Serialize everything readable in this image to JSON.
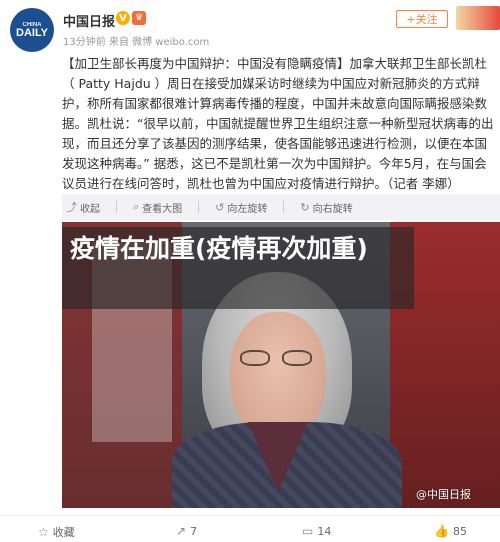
{
  "header": {
    "avatar_small": "CHINA",
    "avatar_big": "DAILY",
    "user_name": "中国日报",
    "verified_badge": "V",
    "meta": "13分钟前 来自 微博 weibo.com",
    "follow_label": "+关注"
  },
  "post": {
    "text": "【加卫生部长再度为中国辩护：中国没有隐瞒疫情】加拿大联邦卫生部长凯杜（ Patty Hajdu ）周日在接受加媒采访时继续为中国应对新冠肺炎的方式辩护，称所有国家都很难计算病毒传播的程度，中国并未故意向国际瞒报感染数据。凯杜说：“很早以前，中国就提醒世界卫生组织注意一种新型冠状病毒的出现，而且还分享了该基因的测序结果，使各国能够迅速进行检测，以便在本国发现这种病毒。” 据悉，这已不是凯杜第一次为中国辩护。今年5月，在与国会议员进行在线问答时，凯杜也曾为中国应对疫情进行辩护。（记者 李娜）"
  },
  "image_toolbar": {
    "collapse": "收起",
    "view_large": "查看大图",
    "rotate_left": "向左旋转",
    "rotate_right": "向右旋转"
  },
  "image": {
    "overlay_title": "疫情在加重(疫情再次加重)",
    "watermark": "@中国日报"
  },
  "actions": {
    "favorite": "收藏",
    "forward_count": "7",
    "comment_count": "14",
    "like_count": "85"
  },
  "colors": {
    "accent": "#ff8140",
    "avatar_bg": "#1c4f8f"
  }
}
